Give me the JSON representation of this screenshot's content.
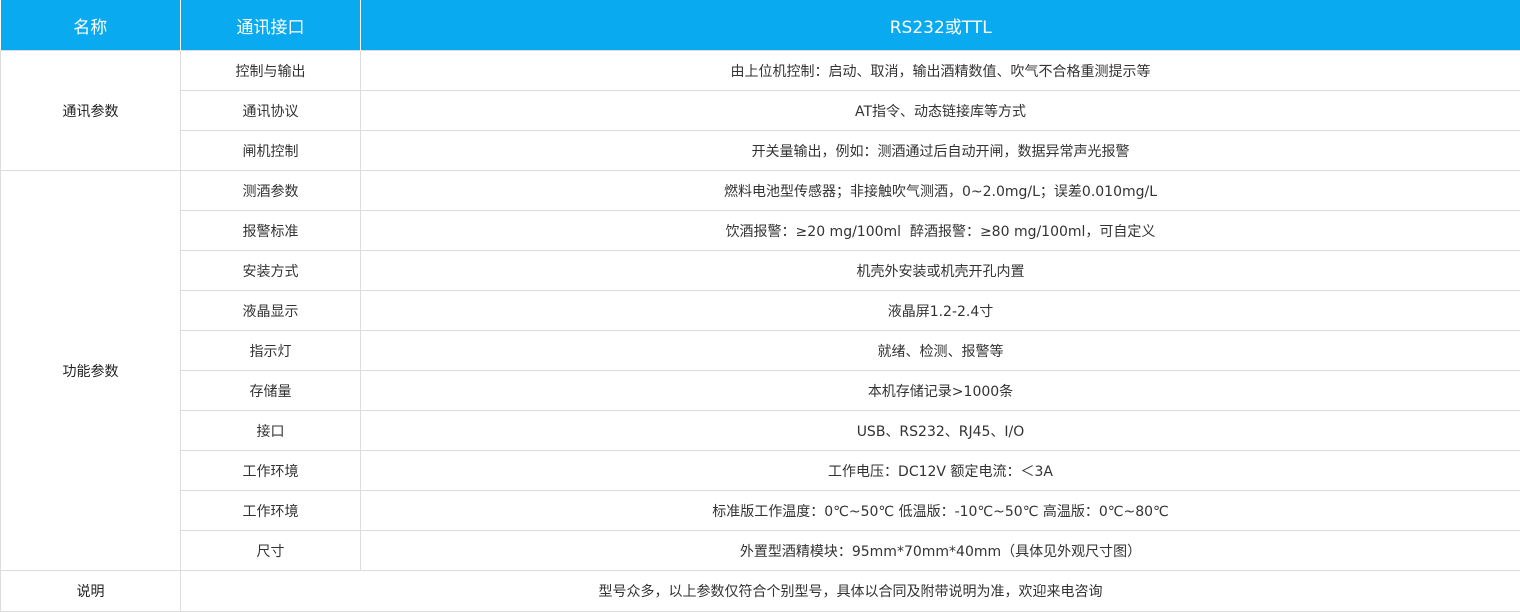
{
  "header": {
    "col_name": "名称",
    "col_interface": "通讯接口",
    "col_value": "RS232或TTL"
  },
  "groups": {
    "communication": "通讯参数",
    "function": "功能参数",
    "note": "说明"
  },
  "rows": [
    {
      "name": "控制与输出",
      "value": "由上位机控制：启动、取消，输出酒精数值、吹气不合格重测提示等"
    },
    {
      "name": "通讯协议",
      "value": "AT指令、动态链接库等方式"
    },
    {
      "name": "闸机控制",
      "value": "开关量输出，例如：测酒通过后自动开闸，数据异常声光报警"
    },
    {
      "name": "测酒参数",
      "value": "燃料电池型传感器；非接触吹气测酒，0~2.0mg/L；误差0.010mg/L"
    },
    {
      "name": "报警标准",
      "value": "饮酒报警：≥20 mg/100ml  醉酒报警：≥80 mg/100ml，可自定义"
    },
    {
      "name": "安装方式",
      "value": "机壳外安装或机壳开孔内置"
    },
    {
      "name": "液晶显示",
      "value": "液晶屏1.2-2.4寸"
    },
    {
      "name": "指示灯",
      "value": "就绪、检测、报警等"
    },
    {
      "name": "存储量",
      "value": "本机存储记录>1000条"
    },
    {
      "name": "接口",
      "value": "USB、RS232、RJ45、I/O"
    },
    {
      "name": "工作环境",
      "value": "工作电压：DC12V 额定电流：＜3A"
    },
    {
      "name": "工作环境",
      "value": "标准版工作温度：0℃~50℃ 低温版：-10℃~50℃ 高温版：0℃~80℃"
    },
    {
      "name": "尺寸",
      "value": "外置型酒精模块：95mm*70mm*40mm（具体见外观尺寸图）"
    }
  ],
  "note_text": "型号众多，以上参数仅符合个别型号，具体以合同及附带说明为准，欢迎来电咨询",
  "colors": {
    "header_bg": "#0aaaf0",
    "header_text": "#ffffff",
    "border": "#dcdcdc",
    "body_text": "#333333"
  }
}
